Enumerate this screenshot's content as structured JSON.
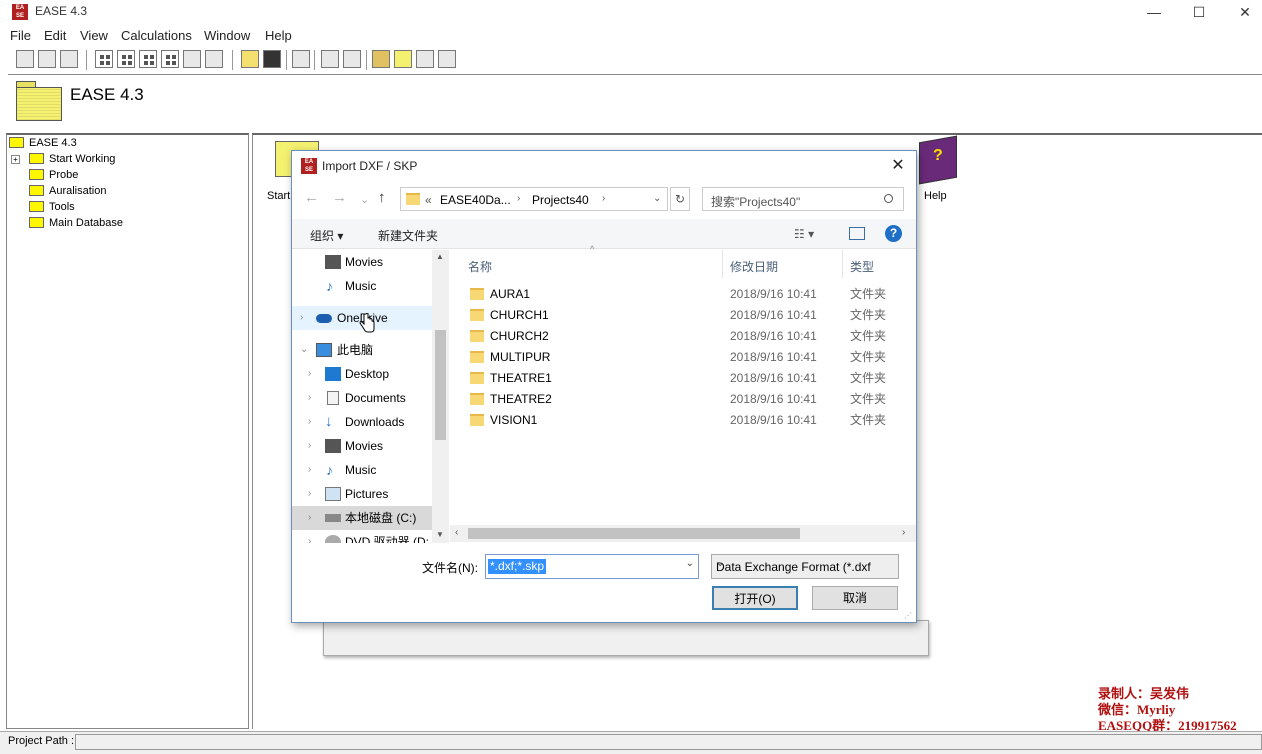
{
  "app": {
    "title": "EASE 4.3",
    "icon": "ease-logo-icon"
  },
  "window_controls": {
    "minimize": "—",
    "maximize": "☐",
    "close": "✕"
  },
  "menu": [
    "File",
    "Edit",
    "View",
    "Calculations",
    "Window",
    "Help"
  ],
  "header": {
    "title": "EASE 4.3"
  },
  "tree": {
    "root": "EASE 4.3",
    "items": [
      "Start Working",
      "Probe",
      "Auralisation",
      "Tools",
      "Main Database"
    ]
  },
  "right_panel": {
    "start_label": "Start",
    "help_label": "Help"
  },
  "dialog": {
    "title": "Import DXF / SKP",
    "close": "✕",
    "address": {
      "prefix": "«",
      "crumbs": [
        "EASE40Da...",
        "Projects40"
      ]
    },
    "search_placeholder": "搜索\"Projects40\"",
    "organize": "组织 ▾",
    "new_folder": "新建文件夹",
    "nav_items": [
      {
        "label": "Movies",
        "icon": "film-icon"
      },
      {
        "label": "Music",
        "icon": "music-note-icon"
      },
      {
        "label": "OneDrive",
        "icon": "cloud-icon"
      },
      {
        "label": "此电脑",
        "icon": "computer-icon"
      },
      {
        "label": "Desktop",
        "icon": "desktop-icon"
      },
      {
        "label": "Documents",
        "icon": "document-icon"
      },
      {
        "label": "Downloads",
        "icon": "download-arrow-icon"
      },
      {
        "label": "Movies",
        "icon": "film-icon"
      },
      {
        "label": "Music",
        "icon": "music-note-icon"
      },
      {
        "label": "Pictures",
        "icon": "picture-icon"
      },
      {
        "label": "本地磁盘 (C:)",
        "icon": "drive-icon"
      },
      {
        "label": "DVD 驱动器 (D:",
        "icon": "dvd-icon"
      }
    ],
    "columns": {
      "name": "名称",
      "date": "修改日期",
      "type": "类型"
    },
    "files": [
      {
        "name": "AURA1",
        "date": "2018/9/16 10:41",
        "type": "文件夹"
      },
      {
        "name": "CHURCH1",
        "date": "2018/9/16 10:41",
        "type": "文件夹"
      },
      {
        "name": "CHURCH2",
        "date": "2018/9/16 10:41",
        "type": "文件夹"
      },
      {
        "name": "MULTIPUR",
        "date": "2018/9/16 10:41",
        "type": "文件夹"
      },
      {
        "name": "THEATRE1",
        "date": "2018/9/16 10:41",
        "type": "文件夹"
      },
      {
        "name": "THEATRE2",
        "date": "2018/9/16 10:41",
        "type": "文件夹"
      },
      {
        "name": "VISION1",
        "date": "2018/9/16 10:41",
        "type": "文件夹"
      }
    ],
    "filename_label": "文件名(N):",
    "filename_value": "*.dxf;*.skp",
    "filetype_value": "Data Exchange Format (*.dxf",
    "open_button": "打开(O)",
    "cancel_button": "取消"
  },
  "status": {
    "label": "Project Path :"
  },
  "watermark": [
    "录制人：吴发伟",
    "微信：Myrliy",
    "EASEQQ群：219917562"
  ]
}
